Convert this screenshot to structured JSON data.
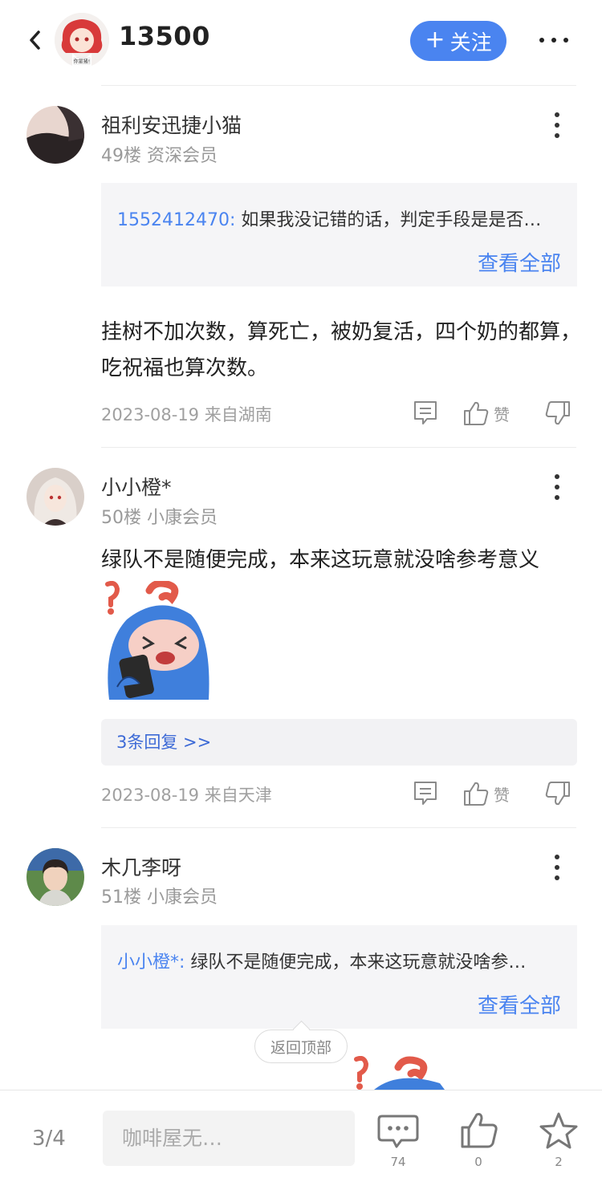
{
  "header": {
    "title": "13500",
    "follow_label": "关注",
    "avatar_caption": "你是猪!"
  },
  "comments": [
    {
      "username": "祖利安迅捷小猫",
      "floor": "49楼 资深会员",
      "quote_user": "1552412470:",
      "quote_text": "如果我没记错的话，判定手段是是否…",
      "quote_more": "查看全部",
      "text": "挂树不加次数，算死亡，被奶复活，四个奶的都算，吃祝福也算次数。",
      "meta": "2023-08-19 来自湖南",
      "zan": "赞"
    },
    {
      "username": "小小橙*",
      "floor": "50楼 小康会员",
      "text": "绿队不是随便完成，本来这玩意就没啥参考意义",
      "replies": "3条回复 >>",
      "meta": "2023-08-19 来自天津",
      "zan": "赞"
    },
    {
      "username": "木几李呀",
      "floor": "51楼 小康会员",
      "quote_user": "小小橙*:",
      "quote_text": "绿队不是随便完成，本来这玩意就没啥参…",
      "quote_more": "查看全部"
    }
  ],
  "back_to_top": "返回顶部",
  "bottom_bar": {
    "page": "3/4",
    "input_placeholder": "咖啡屋无…",
    "comment_count": "74",
    "like_count": "0",
    "favorite_count": "2"
  },
  "colors": {
    "accent": "#4a84f0",
    "reply_link": "#3d6ad6",
    "quote_bg": "#f5f5f7"
  }
}
